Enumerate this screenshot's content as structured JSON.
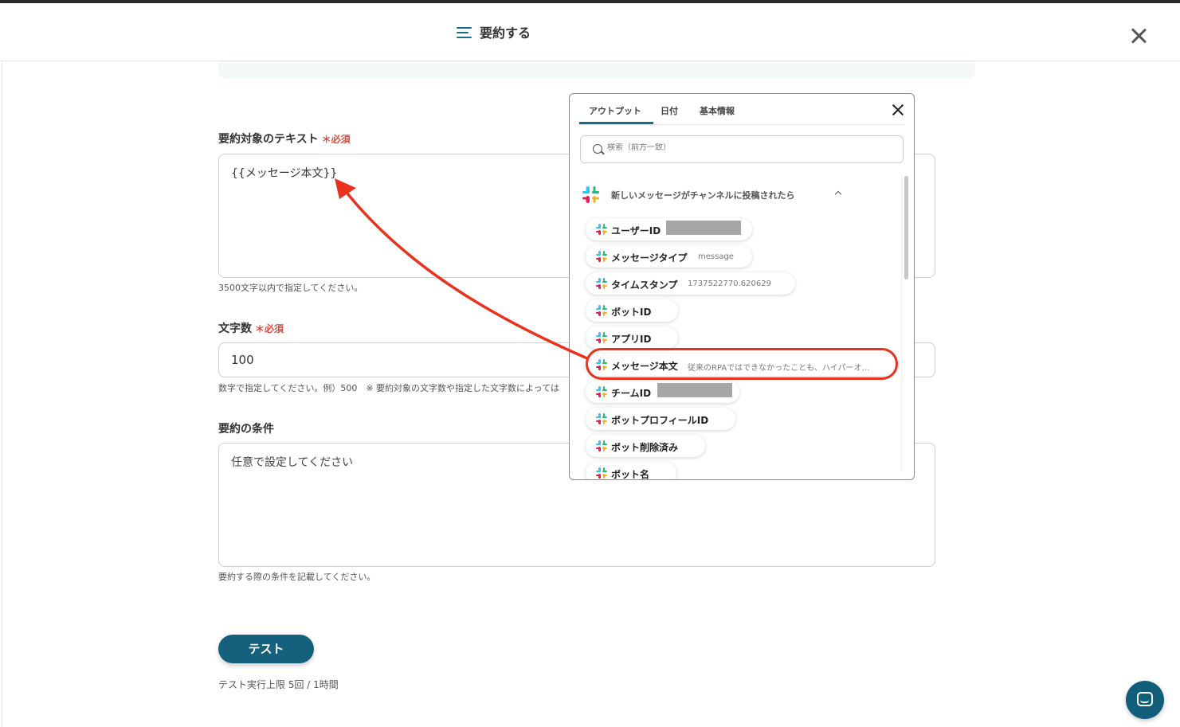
{
  "header": {
    "title": "要約する"
  },
  "form": {
    "text_label": "要約対象のテキスト",
    "required_mark": "＊必須",
    "text_value": "{{メッセージ本文}}",
    "text_help": "3500文字以内で指定してください。",
    "count_label": "文字数",
    "count_value": "100",
    "count_help": "数字で指定してください。例）500　※ 要約対象の文字数や指定した文字数によっては",
    "cond_label": "要約の条件",
    "cond_placeholder": "任意で設定してください",
    "cond_help": "要約する際の条件を記載してください。"
  },
  "test": {
    "button_label": "テスト",
    "note": "テスト実行上限 5回 / 1時間"
  },
  "popup": {
    "tabs": [
      "アウトプット",
      "日付",
      "基本情報"
    ],
    "active_tab": "アウトプット",
    "search_placeholder": "検索（前方一致）",
    "group_title": "新しいメッセージがチャンネルに投稿されたら",
    "items": [
      {
        "name": "ユーザーID",
        "value": ""
      },
      {
        "name": "メッセージタイプ",
        "value": "message"
      },
      {
        "name": "タイムスタンプ",
        "value": "1737522770.620629"
      },
      {
        "name": "ボットID",
        "value": ""
      },
      {
        "name": "アプリID",
        "value": ""
      },
      {
        "name": "メッセージ本文",
        "value": "従来のRPAではできなかったことも、ハイパーオ…"
      },
      {
        "name": "チームID",
        "value": ""
      },
      {
        "name": "ボットプロフィールID",
        "value": ""
      },
      {
        "name": "ボット削除済み",
        "value": ""
      },
      {
        "name": "ボット名",
        "value": ""
      }
    ]
  },
  "colors": {
    "accent": "#15607d",
    "required": "#e2483d",
    "annotation": "#e8321e"
  },
  "icons": {
    "header": "list-lines-icon",
    "close": "close-icon",
    "search": "search-icon",
    "app": "slack-icon",
    "chat": "chat-icon"
  }
}
